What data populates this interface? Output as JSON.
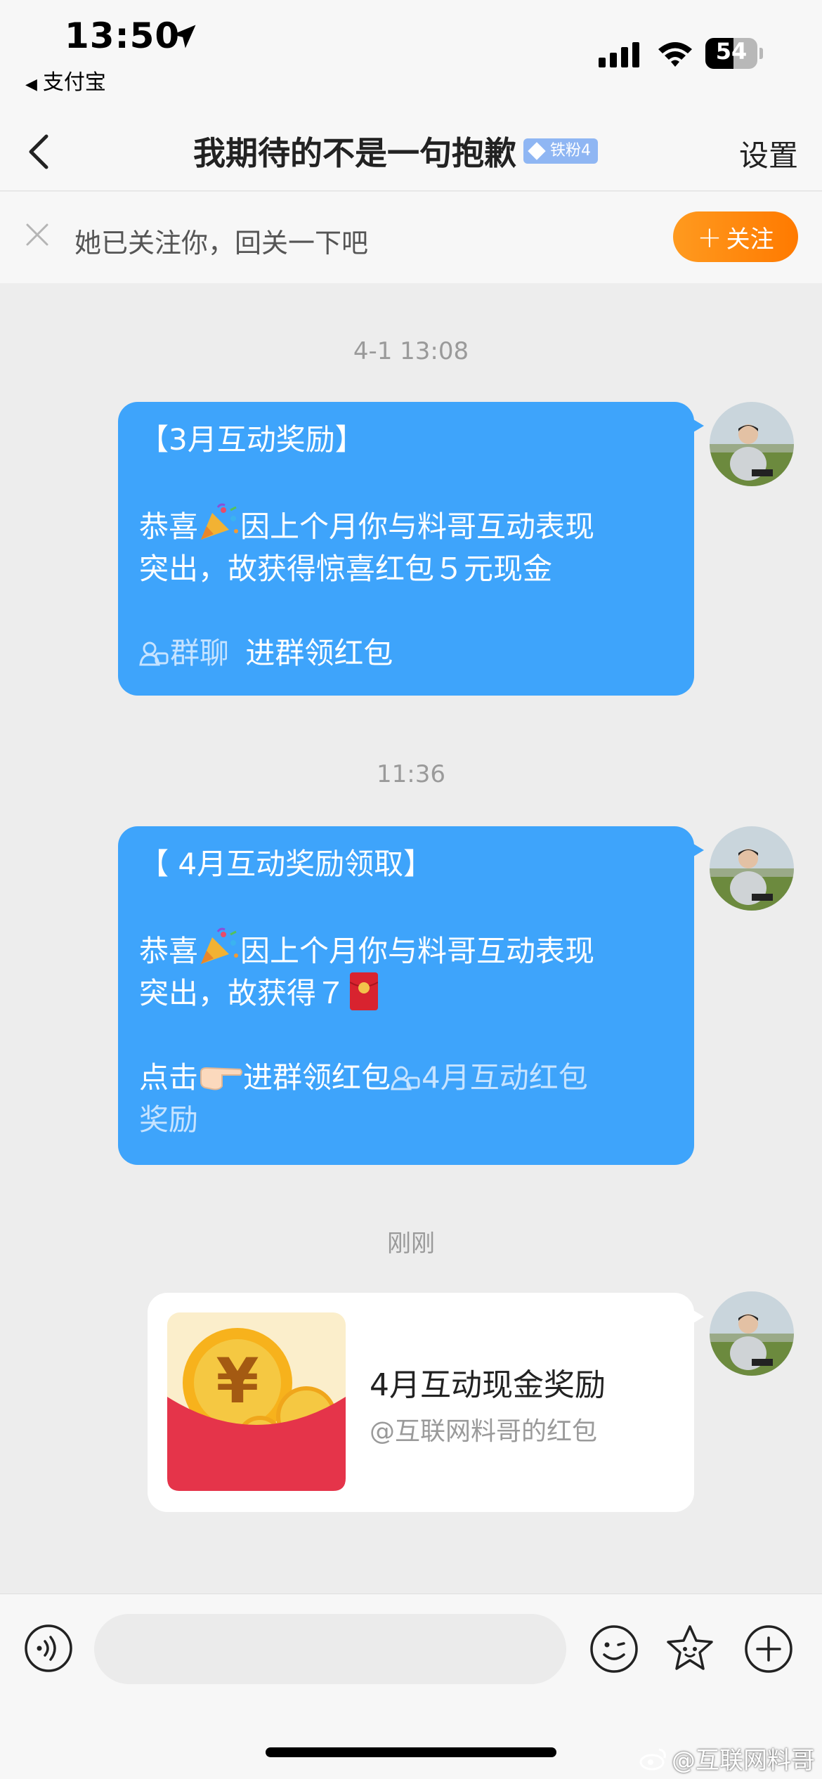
{
  "status_bar": {
    "time": "13:50",
    "back_app": "支付宝",
    "battery": "54",
    "battery_level": 0.54
  },
  "header": {
    "title": "我期待的不是一句抱歉",
    "fan_badge": "铁粉4",
    "settings": "设置"
  },
  "follow_banner": {
    "text": "她已关注你，回关一下吧",
    "button": "关注"
  },
  "messages": [
    {
      "timestamp": "4-1 13:08",
      "line1": "【3月互动奖励】",
      "line2": "恭喜",
      "line3": "因上个月你与料哥互动表现",
      "line4": "突出，故获得惊喜红包５元现金",
      "group_link": "群聊",
      "tail": "进群领红包"
    },
    {
      "timestamp": "11:36",
      "line1": "【 4月互动奖励领取】",
      "line2": "恭喜",
      "line3": "因上个月你与料哥互动表现",
      "line4": "突出，故获得７",
      "line5": "点击",
      "line6": "进群领红包",
      "link_a": "4月互动红包",
      "link_b": "奖励"
    },
    {
      "timestamp": "刚刚",
      "title": "4月互动现金奖励",
      "subtitle": "@互联网料哥的红包"
    }
  ],
  "watermark": "@互联网料哥",
  "colors": {
    "bubble_blue": "#3ea4fb",
    "follow_orange": "#ff8a0a",
    "background": "#ededed",
    "red_packet": "#e5344a"
  },
  "icons": [
    "location-arrow-icon",
    "signal-icon",
    "wifi-icon",
    "back-chevron-icon",
    "close-icon",
    "plus-icon",
    "group-chat-icon",
    "party-popper-icon",
    "pointing-hand-icon",
    "red-envelope-icon",
    "voice-icon",
    "emoji-icon",
    "star-icon",
    "add-icon",
    "weibo-icon"
  ]
}
